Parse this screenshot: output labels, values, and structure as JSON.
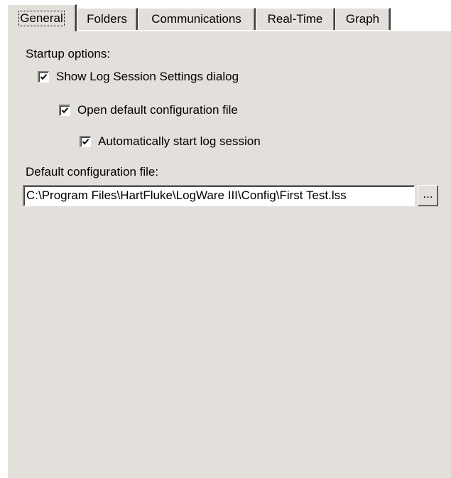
{
  "tabs": [
    {
      "label": "General",
      "active": true
    },
    {
      "label": "Folders",
      "active": false
    },
    {
      "label": "Communications",
      "active": false
    },
    {
      "label": "Real-Time",
      "active": false
    },
    {
      "label": "Graph",
      "active": false
    }
  ],
  "general": {
    "startup_label": "Startup options:",
    "options": [
      {
        "label": "Show Log Session Settings dialog",
        "checked": true
      },
      {
        "label": "Open default configuration file",
        "checked": true
      },
      {
        "label": "Automatically start log session",
        "checked": true
      }
    ],
    "config_label": "Default configuration file:",
    "config_value": "C:\\Program Files\\HartFluke\\LogWare III\\Config\\First Test.lss",
    "browse_label": "..."
  },
  "colors": {
    "panel_bg": "#e3e0db",
    "field_bg": "#ffffff"
  },
  "icons": {
    "checkmark": "check-icon"
  }
}
